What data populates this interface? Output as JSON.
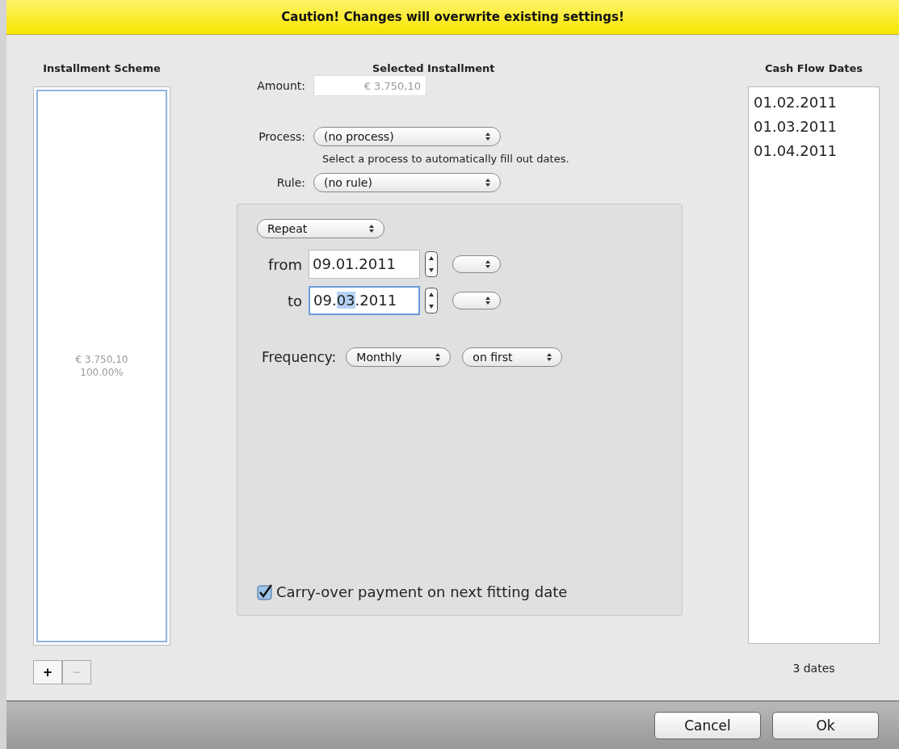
{
  "banner": {
    "text": "Caution! Changes will overwrite existing settings!"
  },
  "installment_scheme": {
    "title": "Installment Scheme",
    "items": [
      {
        "amount": "€ 3.750,10",
        "percent": "100.00%",
        "selected": false
      }
    ],
    "add_button": {
      "label": "+",
      "disabled": false
    },
    "remove_button": {
      "label": "−",
      "disabled": true
    }
  },
  "selected_installment": {
    "title": "Selected Installment",
    "amount": {
      "label": "Amount:",
      "value": "€ 3.750,10",
      "disabled": true
    },
    "process": {
      "label": "Process:",
      "value": "(no process)",
      "hint": "Select a process to automatically fill out dates."
    },
    "rule": {
      "label": "Rule:",
      "value": "(no rule)"
    },
    "repeat": {
      "mode": "Repeat",
      "from": {
        "label": "from",
        "segments": [
          {
            "text": "09.01.2011",
            "selected": false
          }
        ],
        "focused": false
      },
      "to": {
        "label": "to",
        "segments": [
          {
            "text": "09.",
            "selected": false
          },
          {
            "text": "03",
            "selected": true
          },
          {
            "text": ".2011",
            "selected": false
          }
        ],
        "focused": true
      },
      "frequency": {
        "label": "Frequency:",
        "value": "Monthly",
        "day": "on first"
      },
      "carry_over": {
        "label": "Carry-over payment on next fitting date",
        "checked": true
      }
    }
  },
  "cash_flow_dates": {
    "title": "Cash Flow Dates",
    "dates": [
      "01.02.2011",
      "01.03.2011",
      "01.04.2011"
    ],
    "count": "3 dates"
  },
  "buttons": [
    {
      "label": "Cancel",
      "default": false
    },
    {
      "label": "Ok",
      "default": false
    }
  ]
}
